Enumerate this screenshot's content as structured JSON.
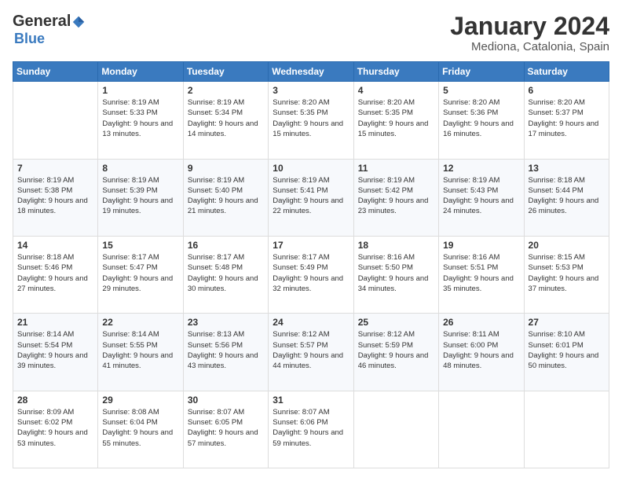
{
  "logo": {
    "general": "General",
    "blue": "Blue"
  },
  "header": {
    "month": "January 2024",
    "location": "Mediona, Catalonia, Spain"
  },
  "weekdays": [
    "Sunday",
    "Monday",
    "Tuesday",
    "Wednesday",
    "Thursday",
    "Friday",
    "Saturday"
  ],
  "weeks": [
    [
      {
        "day": "",
        "sunrise": "",
        "sunset": "",
        "daylight": ""
      },
      {
        "day": "1",
        "sunrise": "Sunrise: 8:19 AM",
        "sunset": "Sunset: 5:33 PM",
        "daylight": "Daylight: 9 hours and 13 minutes."
      },
      {
        "day": "2",
        "sunrise": "Sunrise: 8:19 AM",
        "sunset": "Sunset: 5:34 PM",
        "daylight": "Daylight: 9 hours and 14 minutes."
      },
      {
        "day": "3",
        "sunrise": "Sunrise: 8:20 AM",
        "sunset": "Sunset: 5:35 PM",
        "daylight": "Daylight: 9 hours and 15 minutes."
      },
      {
        "day": "4",
        "sunrise": "Sunrise: 8:20 AM",
        "sunset": "Sunset: 5:35 PM",
        "daylight": "Daylight: 9 hours and 15 minutes."
      },
      {
        "day": "5",
        "sunrise": "Sunrise: 8:20 AM",
        "sunset": "Sunset: 5:36 PM",
        "daylight": "Daylight: 9 hours and 16 minutes."
      },
      {
        "day": "6",
        "sunrise": "Sunrise: 8:20 AM",
        "sunset": "Sunset: 5:37 PM",
        "daylight": "Daylight: 9 hours and 17 minutes."
      }
    ],
    [
      {
        "day": "7",
        "sunrise": "Sunrise: 8:19 AM",
        "sunset": "Sunset: 5:38 PM",
        "daylight": "Daylight: 9 hours and 18 minutes."
      },
      {
        "day": "8",
        "sunrise": "Sunrise: 8:19 AM",
        "sunset": "Sunset: 5:39 PM",
        "daylight": "Daylight: 9 hours and 19 minutes."
      },
      {
        "day": "9",
        "sunrise": "Sunrise: 8:19 AM",
        "sunset": "Sunset: 5:40 PM",
        "daylight": "Daylight: 9 hours and 21 minutes."
      },
      {
        "day": "10",
        "sunrise": "Sunrise: 8:19 AM",
        "sunset": "Sunset: 5:41 PM",
        "daylight": "Daylight: 9 hours and 22 minutes."
      },
      {
        "day": "11",
        "sunrise": "Sunrise: 8:19 AM",
        "sunset": "Sunset: 5:42 PM",
        "daylight": "Daylight: 9 hours and 23 minutes."
      },
      {
        "day": "12",
        "sunrise": "Sunrise: 8:19 AM",
        "sunset": "Sunset: 5:43 PM",
        "daylight": "Daylight: 9 hours and 24 minutes."
      },
      {
        "day": "13",
        "sunrise": "Sunrise: 8:18 AM",
        "sunset": "Sunset: 5:44 PM",
        "daylight": "Daylight: 9 hours and 26 minutes."
      }
    ],
    [
      {
        "day": "14",
        "sunrise": "Sunrise: 8:18 AM",
        "sunset": "Sunset: 5:46 PM",
        "daylight": "Daylight: 9 hours and 27 minutes."
      },
      {
        "day": "15",
        "sunrise": "Sunrise: 8:17 AM",
        "sunset": "Sunset: 5:47 PM",
        "daylight": "Daylight: 9 hours and 29 minutes."
      },
      {
        "day": "16",
        "sunrise": "Sunrise: 8:17 AM",
        "sunset": "Sunset: 5:48 PM",
        "daylight": "Daylight: 9 hours and 30 minutes."
      },
      {
        "day": "17",
        "sunrise": "Sunrise: 8:17 AM",
        "sunset": "Sunset: 5:49 PM",
        "daylight": "Daylight: 9 hours and 32 minutes."
      },
      {
        "day": "18",
        "sunrise": "Sunrise: 8:16 AM",
        "sunset": "Sunset: 5:50 PM",
        "daylight": "Daylight: 9 hours and 34 minutes."
      },
      {
        "day": "19",
        "sunrise": "Sunrise: 8:16 AM",
        "sunset": "Sunset: 5:51 PM",
        "daylight": "Daylight: 9 hours and 35 minutes."
      },
      {
        "day": "20",
        "sunrise": "Sunrise: 8:15 AM",
        "sunset": "Sunset: 5:53 PM",
        "daylight": "Daylight: 9 hours and 37 minutes."
      }
    ],
    [
      {
        "day": "21",
        "sunrise": "Sunrise: 8:14 AM",
        "sunset": "Sunset: 5:54 PM",
        "daylight": "Daylight: 9 hours and 39 minutes."
      },
      {
        "day": "22",
        "sunrise": "Sunrise: 8:14 AM",
        "sunset": "Sunset: 5:55 PM",
        "daylight": "Daylight: 9 hours and 41 minutes."
      },
      {
        "day": "23",
        "sunrise": "Sunrise: 8:13 AM",
        "sunset": "Sunset: 5:56 PM",
        "daylight": "Daylight: 9 hours and 43 minutes."
      },
      {
        "day": "24",
        "sunrise": "Sunrise: 8:12 AM",
        "sunset": "Sunset: 5:57 PM",
        "daylight": "Daylight: 9 hours and 44 minutes."
      },
      {
        "day": "25",
        "sunrise": "Sunrise: 8:12 AM",
        "sunset": "Sunset: 5:59 PM",
        "daylight": "Daylight: 9 hours and 46 minutes."
      },
      {
        "day": "26",
        "sunrise": "Sunrise: 8:11 AM",
        "sunset": "Sunset: 6:00 PM",
        "daylight": "Daylight: 9 hours and 48 minutes."
      },
      {
        "day": "27",
        "sunrise": "Sunrise: 8:10 AM",
        "sunset": "Sunset: 6:01 PM",
        "daylight": "Daylight: 9 hours and 50 minutes."
      }
    ],
    [
      {
        "day": "28",
        "sunrise": "Sunrise: 8:09 AM",
        "sunset": "Sunset: 6:02 PM",
        "daylight": "Daylight: 9 hours and 53 minutes."
      },
      {
        "day": "29",
        "sunrise": "Sunrise: 8:08 AM",
        "sunset": "Sunset: 6:04 PM",
        "daylight": "Daylight: 9 hours and 55 minutes."
      },
      {
        "day": "30",
        "sunrise": "Sunrise: 8:07 AM",
        "sunset": "Sunset: 6:05 PM",
        "daylight": "Daylight: 9 hours and 57 minutes."
      },
      {
        "day": "31",
        "sunrise": "Sunrise: 8:07 AM",
        "sunset": "Sunset: 6:06 PM",
        "daylight": "Daylight: 9 hours and 59 minutes."
      },
      {
        "day": "",
        "sunrise": "",
        "sunset": "",
        "daylight": ""
      },
      {
        "day": "",
        "sunrise": "",
        "sunset": "",
        "daylight": ""
      },
      {
        "day": "",
        "sunrise": "",
        "sunset": "",
        "daylight": ""
      }
    ]
  ]
}
